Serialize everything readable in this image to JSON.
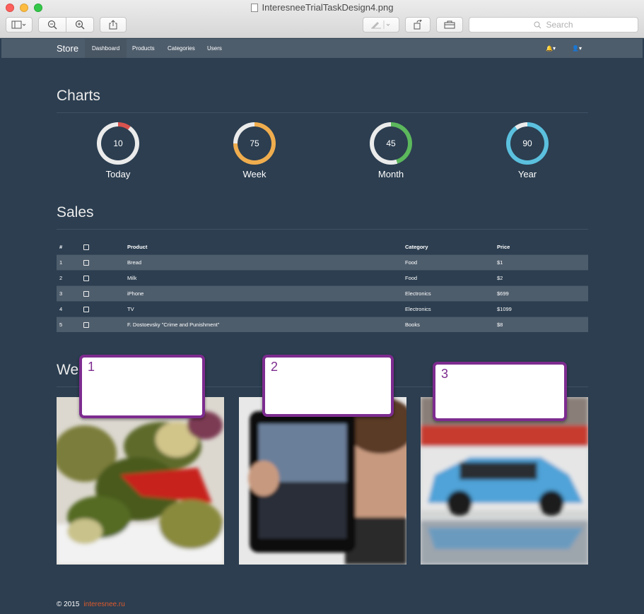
{
  "window": {
    "title": "InteresneeTrialTaskDesign4.png",
    "search_placeholder": "Search"
  },
  "navbar": {
    "brand": "Store",
    "items": [
      {
        "label": "Dashboard",
        "active": true
      },
      {
        "label": "Products",
        "active": false
      },
      {
        "label": "Categories",
        "active": false
      },
      {
        "label": "Users",
        "active": false
      }
    ],
    "icons": [
      "bell-icon",
      "user-icon"
    ]
  },
  "charts": {
    "title": "Charts",
    "items": [
      {
        "value": "10",
        "label": "Today",
        "percent": 10,
        "color": "#d9534f"
      },
      {
        "value": "75",
        "label": "Week",
        "percent": 75,
        "color": "#f0ad4e"
      },
      {
        "value": "45",
        "label": "Month",
        "percent": 45,
        "color": "#5cb85c"
      },
      {
        "value": "90",
        "label": "Year",
        "percent": 90,
        "color": "#5bc0de"
      }
    ],
    "track_color": "#ebebeb"
  },
  "sales": {
    "title": "Sales",
    "columns": [
      "#",
      "",
      "Product",
      "Category",
      "Price"
    ],
    "rows": [
      {
        "num": "1",
        "product": "Bread",
        "category": "Food",
        "price": "$1"
      },
      {
        "num": "2",
        "product": "Milk",
        "category": "Food",
        "price": "$2"
      },
      {
        "num": "3",
        "product": "iPhone",
        "category": "Electronics",
        "price": "$699"
      },
      {
        "num": "4",
        "product": "TV",
        "category": "Electronics",
        "price": "$1099"
      },
      {
        "num": "5",
        "product": "F. Dostoevsky \"Crime and Punishment\"",
        "category": "Books",
        "price": "$8"
      }
    ]
  },
  "gallery": {
    "title": "We",
    "callouts": [
      "1",
      "2",
      "3"
    ]
  },
  "footer": {
    "copyright": "© 2015",
    "link": "interesnee.ru"
  },
  "colors": {
    "background": "#2c3e50",
    "navbar": "#4e5d6c",
    "callout": "#7d2c8f",
    "footer_link": "#e05a2b"
  }
}
